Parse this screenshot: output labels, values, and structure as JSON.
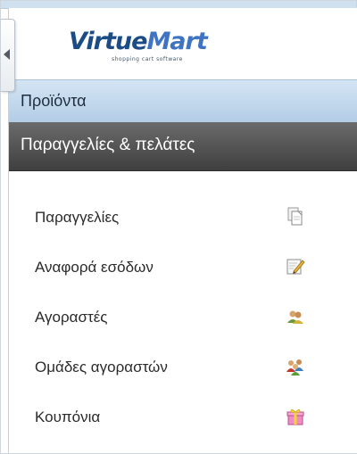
{
  "logo": {
    "brand_first": "Virtue",
    "brand_second": "Mart",
    "tagline": "shopping cart software"
  },
  "menu": {
    "products_label": "Προϊόντα",
    "orders_customers_label": "Παραγγελίες & πελάτες",
    "items": [
      {
        "label": "Παραγγελίες",
        "icon": "orders-documents-icon"
      },
      {
        "label": "Αναφορά εσόδων",
        "icon": "report-edit-icon"
      },
      {
        "label": "Αγοραστές",
        "icon": "shoppers-icon"
      },
      {
        "label": "Ομάδες αγοραστών",
        "icon": "shopper-groups-icon"
      },
      {
        "label": "Κουπόνια",
        "icon": "coupon-gift-icon"
      }
    ]
  },
  "colors": {
    "products_header": "#b3cde6",
    "orders_header": "#4a4a4a",
    "brand_blue": "#1c4c86"
  }
}
